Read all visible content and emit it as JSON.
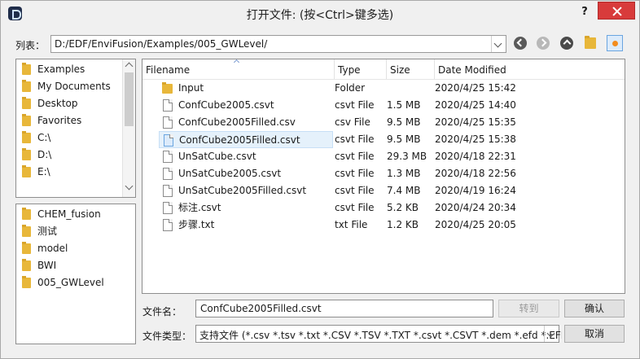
{
  "window": {
    "title": "打开文件: (按<Ctrl>键多选)",
    "help_label": "?",
    "close_label": "×"
  },
  "lookin": {
    "label": "列表：",
    "path": "D:/EDF/EnviFusion/Examples/005_GWLevel/"
  },
  "nav": {
    "back": "arrow-left-icon",
    "forward": "arrow-right-icon",
    "up": "arrow-up-icon",
    "new_folder": "folder-icon",
    "detail_view": "detail-view-icon"
  },
  "sidebar_top": [
    {
      "label": "Examples"
    },
    {
      "label": "My Documents"
    },
    {
      "label": "Desktop"
    },
    {
      "label": "Favorites"
    },
    {
      "label": "C:\\"
    },
    {
      "label": "D:\\"
    },
    {
      "label": "E:\\"
    }
  ],
  "sidebar_bottom": [
    {
      "label": "CHEM_fusion"
    },
    {
      "label": "测试"
    },
    {
      "label": "model"
    },
    {
      "label": "BWI"
    },
    {
      "label": "005_GWLevel"
    }
  ],
  "file_list": {
    "columns": [
      "Filename",
      "Type",
      "Size",
      "Date Modified"
    ],
    "rows": [
      {
        "name": "Input",
        "type": "Folder",
        "size": "",
        "date": "2020/4/25 15:42",
        "kind": "folder",
        "selected": false
      },
      {
        "name": "ConfCube2005.csvt",
        "type": "csvt File",
        "size": "1.5 MB",
        "date": "2020/4/25 14:40",
        "kind": "file",
        "selected": false
      },
      {
        "name": "ConfCube2005Filled.csv",
        "type": "csv File",
        "size": "9.5 MB",
        "date": "2020/4/25 15:35",
        "kind": "file",
        "selected": false
      },
      {
        "name": "ConfCube2005Filled.csvt",
        "type": "csvt File",
        "size": "9.5 MB",
        "date": "2020/4/25 15:38",
        "kind": "file",
        "selected": true
      },
      {
        "name": "UnSatCube.csvt",
        "type": "csvt File",
        "size": "29.3 MB",
        "date": "2020/4/18 22:31",
        "kind": "file",
        "selected": false
      },
      {
        "name": "UnSatCube2005.csvt",
        "type": "csvt File",
        "size": "1.3 MB",
        "date": "2020/4/18 22:56",
        "kind": "file",
        "selected": false
      },
      {
        "name": "UnSatCube2005Filled.csvt",
        "type": "csvt File",
        "size": "7.4 MB",
        "date": "2020/4/19 16:24",
        "kind": "file",
        "selected": false
      },
      {
        "name": "标注.csvt",
        "type": "csvt File",
        "size": "5.2 KB",
        "date": "2020/4/24 20:34",
        "kind": "file",
        "selected": false
      },
      {
        "name": "步骤.txt",
        "type": "txt File",
        "size": "1.2 KB",
        "date": "2020/4/25 20:05",
        "kind": "file",
        "selected": false
      }
    ]
  },
  "filename": {
    "label": "文件名：",
    "value": "ConfCube2005Filled.csvt"
  },
  "filetype": {
    "label": "文件类型：",
    "value": "支持文件 (*.csv *.tsv *.txt *.CSV *.TSV *.TXT *.csvt *.CSVT *.dem *.efd *.EFD"
  },
  "buttons": {
    "goto": "转到",
    "ok": "确认",
    "cancel": "取消"
  },
  "colors": {
    "selection": "#e5f1fb",
    "close_red": "#d83b3b",
    "folder_yellow": "#e8b73a"
  }
}
